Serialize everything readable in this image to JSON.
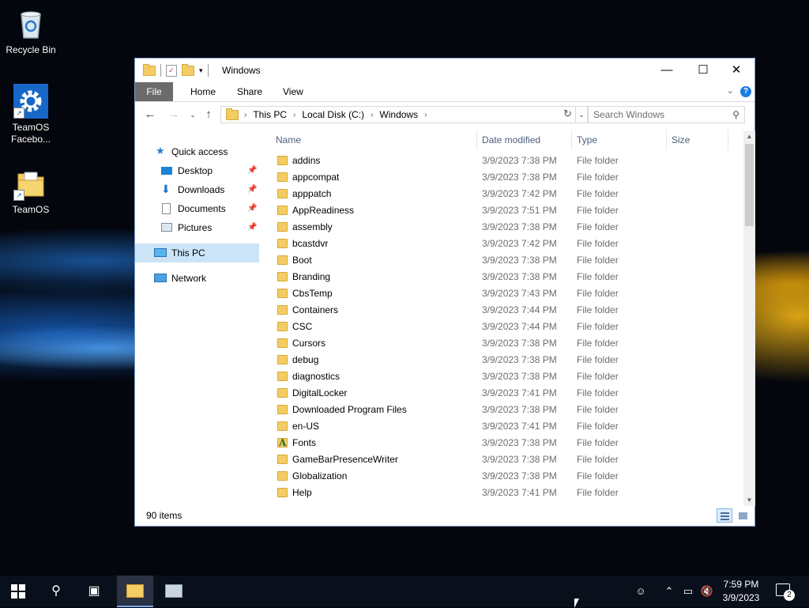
{
  "desktop": {
    "icons": [
      {
        "label": "Recycle Bin"
      },
      {
        "label": "TeamOS Facebo..."
      },
      {
        "label": "TeamOS"
      }
    ]
  },
  "window": {
    "title": "Windows",
    "controls": {
      "minimize": "—",
      "maximize": "☐",
      "close": "✕"
    },
    "ribbon_tabs": [
      "File",
      "Home",
      "Share",
      "View"
    ],
    "address": {
      "crumbs": [
        "This PC",
        "Local Disk (C:)",
        "Windows"
      ]
    },
    "search": {
      "placeholder": "Search Windows"
    },
    "nav_pane": [
      {
        "label": "Quick access",
        "icon": "star-icon"
      },
      {
        "label": "Desktop",
        "icon": "desktop-icon",
        "pinned": true
      },
      {
        "label": "Downloads",
        "icon": "download-icon",
        "pinned": true
      },
      {
        "label": "Documents",
        "icon": "documents-icon",
        "pinned": true
      },
      {
        "label": "Pictures",
        "icon": "pictures-icon",
        "pinned": true
      },
      {
        "label": "This PC",
        "icon": "computer-icon",
        "selected": true
      },
      {
        "label": "Network",
        "icon": "network-icon"
      }
    ],
    "columns": {
      "name": "Name",
      "date": "Date modified",
      "type": "Type",
      "size": "Size"
    },
    "files": [
      {
        "name": "addins",
        "date": "3/9/2023 7:38 PM",
        "type": "File folder"
      },
      {
        "name": "appcompat",
        "date": "3/9/2023 7:38 PM",
        "type": "File folder"
      },
      {
        "name": "apppatch",
        "date": "3/9/2023 7:42 PM",
        "type": "File folder"
      },
      {
        "name": "AppReadiness",
        "date": "3/9/2023 7:51 PM",
        "type": "File folder"
      },
      {
        "name": "assembly",
        "date": "3/9/2023 7:38 PM",
        "type": "File folder"
      },
      {
        "name": "bcastdvr",
        "date": "3/9/2023 7:42 PM",
        "type": "File folder"
      },
      {
        "name": "Boot",
        "date": "3/9/2023 7:38 PM",
        "type": "File folder"
      },
      {
        "name": "Branding",
        "date": "3/9/2023 7:38 PM",
        "type": "File folder"
      },
      {
        "name": "CbsTemp",
        "date": "3/9/2023 7:43 PM",
        "type": "File folder"
      },
      {
        "name": "Containers",
        "date": "3/9/2023 7:44 PM",
        "type": "File folder"
      },
      {
        "name": "CSC",
        "date": "3/9/2023 7:44 PM",
        "type": "File folder"
      },
      {
        "name": "Cursors",
        "date": "3/9/2023 7:38 PM",
        "type": "File folder"
      },
      {
        "name": "debug",
        "date": "3/9/2023 7:38 PM",
        "type": "File folder"
      },
      {
        "name": "diagnostics",
        "date": "3/9/2023 7:38 PM",
        "type": "File folder"
      },
      {
        "name": "DigitalLocker",
        "date": "3/9/2023 7:41 PM",
        "type": "File folder"
      },
      {
        "name": "Downloaded Program Files",
        "date": "3/9/2023 7:38 PM",
        "type": "File folder"
      },
      {
        "name": "en-US",
        "date": "3/9/2023 7:41 PM",
        "type": "File folder"
      },
      {
        "name": "Fonts",
        "date": "3/9/2023 7:38 PM",
        "type": "File folder",
        "icon": "fonts-folder-icon"
      },
      {
        "name": "GameBarPresenceWriter",
        "date": "3/9/2023 7:38 PM",
        "type": "File folder"
      },
      {
        "name": "Globalization",
        "date": "3/9/2023 7:38 PM",
        "type": "File folder"
      },
      {
        "name": "Help",
        "date": "3/9/2023 7:41 PM",
        "type": "File folder"
      }
    ],
    "status": {
      "item_count": "90 items"
    }
  },
  "taskbar": {
    "clock": {
      "time": "7:59 PM",
      "date": "3/9/2023"
    },
    "notification_count": "2"
  },
  "colors": {
    "accent": "#1e7ae0",
    "selection": "#cce4f7",
    "folder": "#f3cd63"
  }
}
